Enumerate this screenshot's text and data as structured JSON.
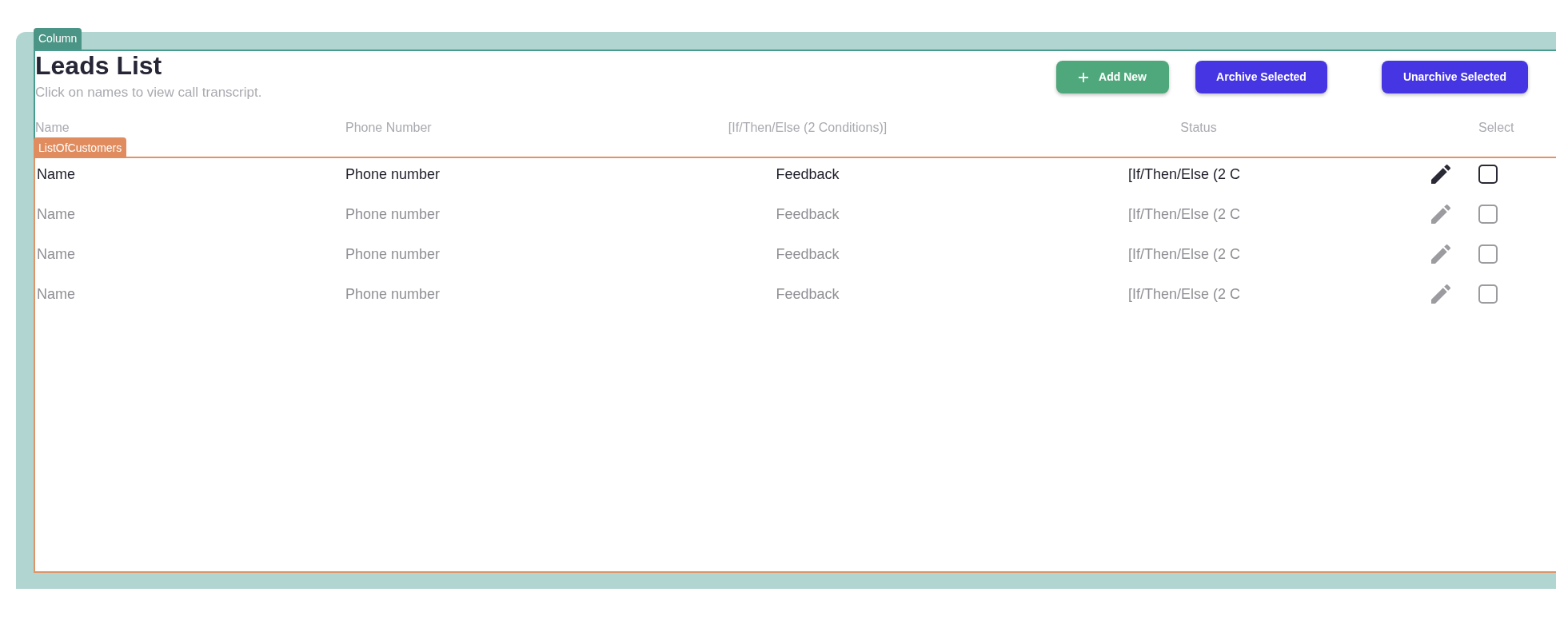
{
  "editor_overlay": {
    "column_tag": "Column",
    "list_tag": "ListOfCustomers"
  },
  "header": {
    "title": "Leads List",
    "subtitle": "Click on names to view call transcript."
  },
  "buttons": [
    {
      "label": "Add New",
      "kind": "add"
    },
    {
      "label": "Archive Selected",
      "kind": "action"
    },
    {
      "label": "Unarchive Selected",
      "kind": "action"
    }
  ],
  "table": {
    "columns": [
      "Name",
      "Phone Number",
      "[If/Then/Else (2 Conditions)]",
      "Status",
      "Select"
    ],
    "rows": [
      {
        "name": "Name",
        "phone": "Phone number",
        "feedback": "Feedback",
        "status": "[If/Then/Else (2 C",
        "dimmed": false,
        "checked": false
      },
      {
        "name": "Name",
        "phone": "Phone number",
        "feedback": "Feedback",
        "status": "[If/Then/Else (2 C",
        "dimmed": true,
        "checked": false
      },
      {
        "name": "Name",
        "phone": "Phone number",
        "feedback": "Feedback",
        "status": "[If/Then/Else (2 C",
        "dimmed": true,
        "checked": false
      },
      {
        "name": "Name",
        "phone": "Phone number",
        "feedback": "Feedback",
        "status": "[If/Then/Else (2 C",
        "dimmed": true,
        "checked": false
      }
    ]
  }
}
